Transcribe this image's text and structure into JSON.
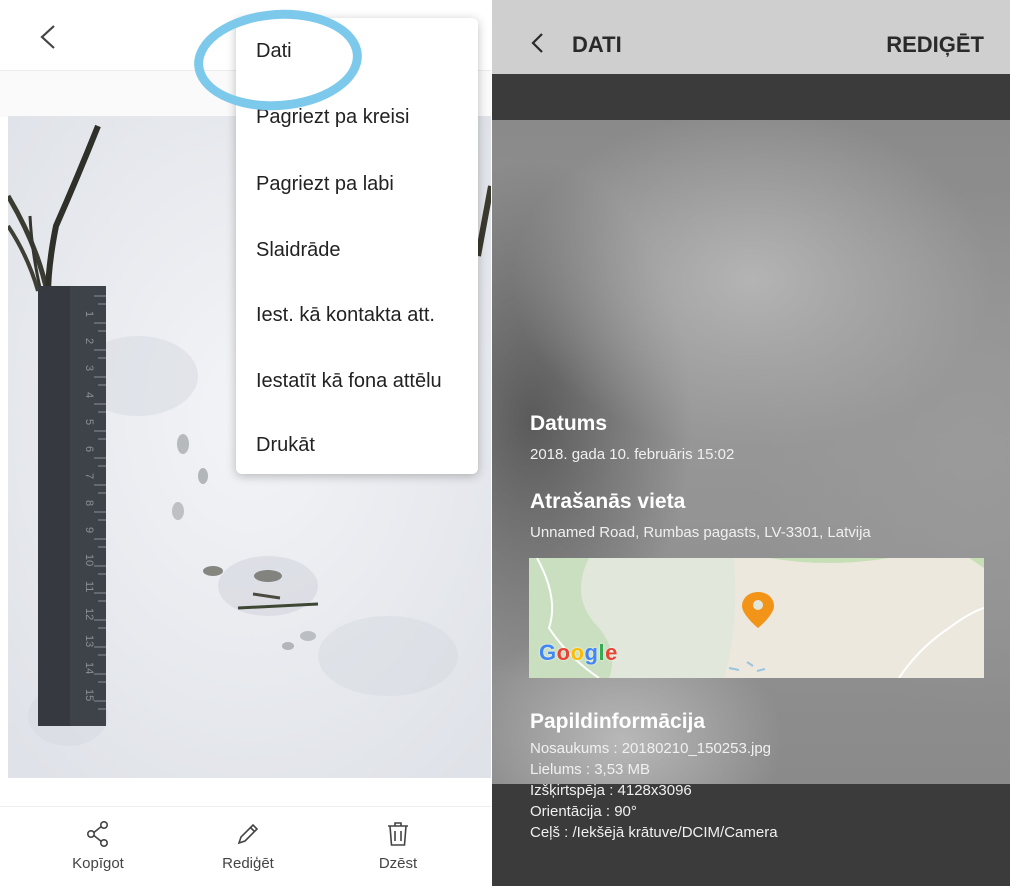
{
  "left": {
    "menu": {
      "items": [
        "Dati",
        "Pagriezt pa kreisi",
        "Pagriezt pa labi",
        "Slaidrāde",
        "Iest. kā kontakta att.",
        "Iestatīt kā fona attēlu",
        "Drukāt"
      ]
    },
    "bottom_bar": {
      "share": "Kopīgot",
      "edit": "Rediģēt",
      "delete": "Dzēst"
    },
    "ruler_numbers": [
      "1",
      "2",
      "3",
      "4",
      "5",
      "6",
      "7",
      "8",
      "9",
      "10",
      "11",
      "12",
      "13",
      "14",
      "15"
    ]
  },
  "right": {
    "title": "DATI",
    "edit_action": "REDIĢĒT",
    "date": {
      "heading": "Datums",
      "value": "2018. gada 10. februāris 15:02"
    },
    "location": {
      "heading": "Atrašanās vieta",
      "value": "Unnamed Road, Rumbas pagasts, LV-3301, Latvija"
    },
    "map": {
      "logo": "Google"
    },
    "details": {
      "heading": "Papildinformācija",
      "lines": [
        "Nosaukums : 20180210_150253.jpg",
        "Lielums : 3,53 MB",
        "Izšķirtspēja : 4128x3096",
        "Orientācija : 90°",
        "Ceļš : /Iekšējā krātuve/DCIM/Camera"
      ]
    }
  },
  "colors": {
    "highlight_circle": "#7cc9ec",
    "map_pin": "#f29417",
    "dark_band": "#3b3b3b",
    "header_gray": "#cfcfcf"
  }
}
